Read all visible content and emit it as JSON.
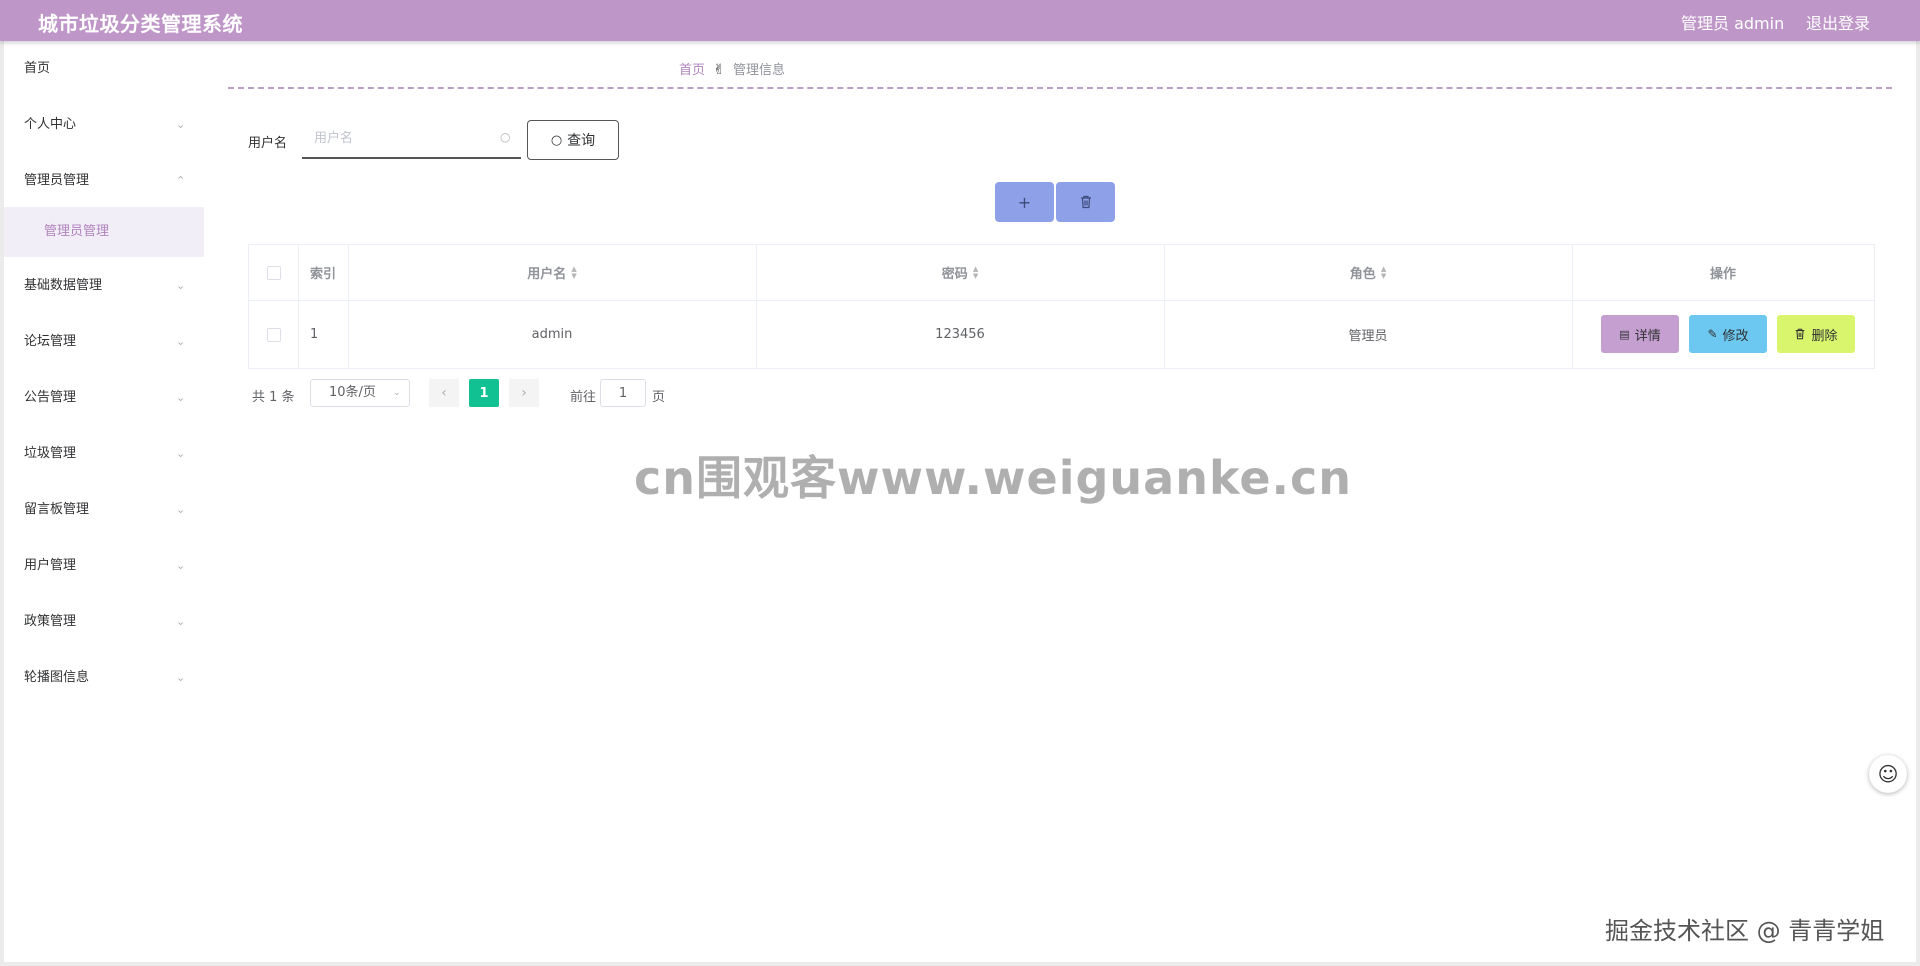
{
  "app": {
    "title": "城市垃圾分类管理系统",
    "user_label": "管理员 admin",
    "logout_label": "退出登录"
  },
  "sidebar": {
    "items": [
      {
        "label": "首页"
      },
      {
        "label": "个人中心"
      },
      {
        "label": "管理员管理"
      },
      {
        "label": "管理员管理"
      },
      {
        "label": "基础数据管理"
      },
      {
        "label": "论坛管理"
      },
      {
        "label": "公告管理"
      },
      {
        "label": "垃圾管理"
      },
      {
        "label": "留言板管理"
      },
      {
        "label": "用户管理"
      },
      {
        "label": "政策管理"
      },
      {
        "label": "轮播图信息"
      }
    ]
  },
  "breadcrumb": {
    "home": "首页",
    "separator": "✌",
    "current": "管理信息"
  },
  "search": {
    "label": "用户名",
    "placeholder": "用户名",
    "value": "",
    "query_label": "查询"
  },
  "table": {
    "columns": [
      "索引",
      "用户名",
      "密码",
      "角色",
      "操作"
    ],
    "rows": [
      {
        "index": "1",
        "username": "admin",
        "password": "123456",
        "role": "管理员"
      }
    ],
    "actions": {
      "detail": "详情",
      "edit": "修改",
      "delete": "删除"
    }
  },
  "pagination": {
    "total_text": "共 1 条",
    "page_size": "10条/页",
    "current_page": "1",
    "goto_label": "前往",
    "goto_value": "1",
    "page_unit": "页"
  },
  "watermark": "cn围观客www.weiguanke.cn",
  "credit": "掘金技术社区 @ 青青学姐",
  "colors": {
    "header": "#bf96c8",
    "accent": "#b183bd",
    "tool_button": "#8ea0e8",
    "detail_button": "#c59fd0",
    "edit_button": "#6cc8f0",
    "delete_button": "#d8f56d",
    "pager_active": "#12c192"
  }
}
